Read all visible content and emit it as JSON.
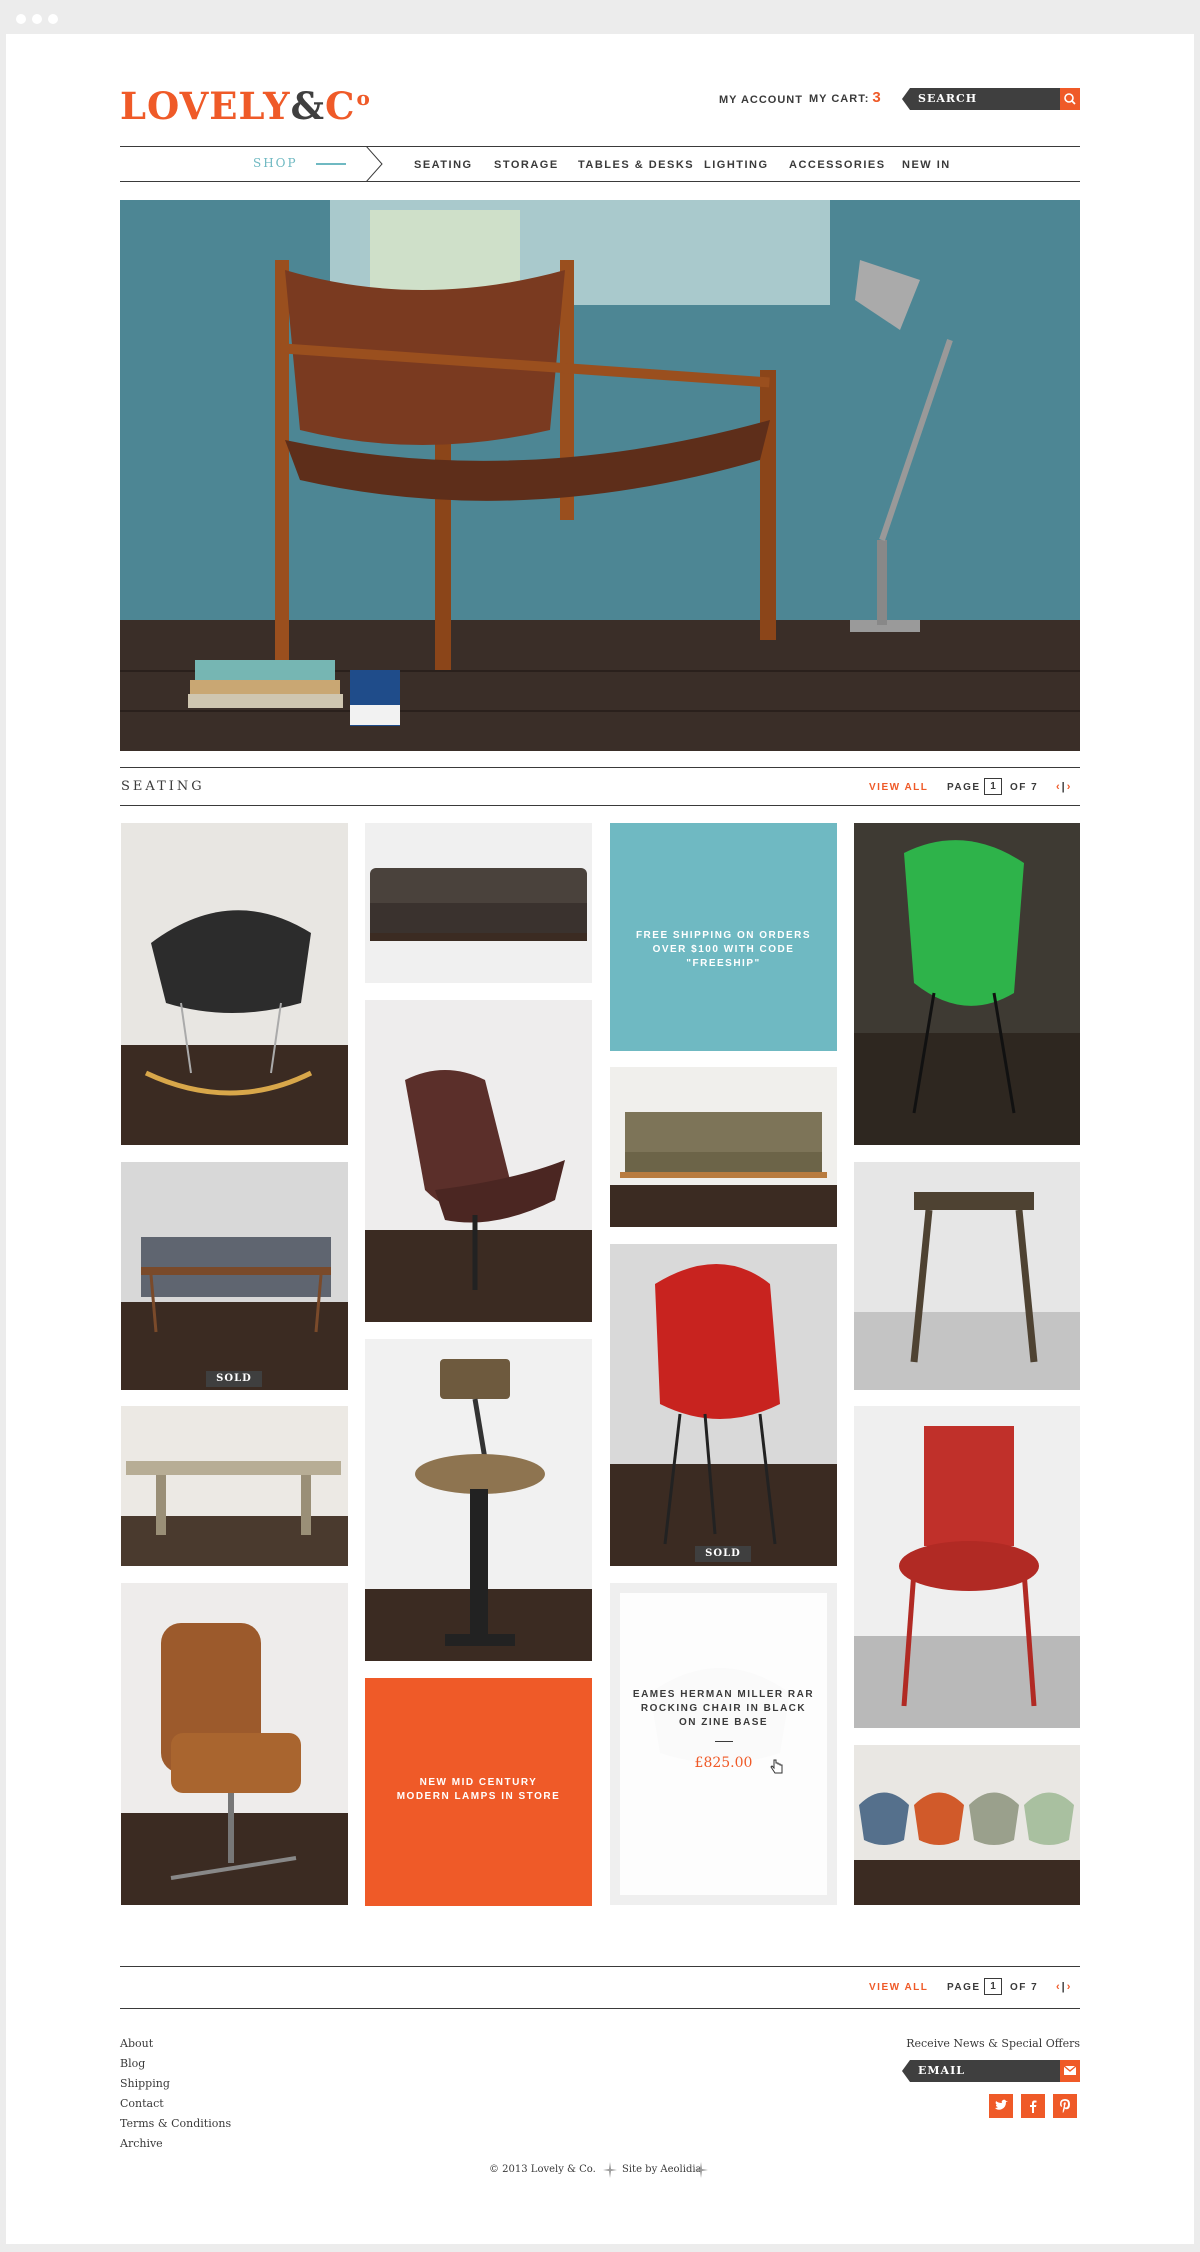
{
  "brand": {
    "logo_main": "LOVELY",
    "logo_amp": "&",
    "logo_co": "C",
    "logo_sup": "o",
    "accent_color": "#ef5a28",
    "secondary_color": "#6fb9c2",
    "dark_color": "#3f3f3f"
  },
  "header": {
    "account_label": "MY ACCOUNT",
    "cart_label": "MY CART:",
    "cart_count": "3",
    "search_placeholder": "SEARCH",
    "search_icon": "search-icon"
  },
  "nav": {
    "shop_label": "SHOP",
    "items": [
      {
        "label": "SEATING"
      },
      {
        "label": "STORAGE"
      },
      {
        "label": "TABLES & DESKS"
      },
      {
        "label": "LIGHTING"
      },
      {
        "label": "ACCESSORIES"
      },
      {
        "label": "NEW IN"
      }
    ]
  },
  "section": {
    "title": "SEATING",
    "view_all": "VIEW ALL",
    "page_label": "PAGE",
    "page_current": "1",
    "page_total": "OF 7",
    "prev": "‹",
    "sep": "|",
    "next": "›"
  },
  "grid": {
    "sold_label": "SOLD",
    "promo_shipping": "FREE SHIPPING ON ORDERS OVER $100 WITH CODE \"FREESHIP\"",
    "promo_lamps": "NEW MID CENTURY MODERN LAMPS IN STORE",
    "hover_product_name": "EAMES HERMAN MILLER RAR ROCKING CHAIR IN BLACK ON ZINE BASE",
    "hover_product_price": "£825.00"
  },
  "footer": {
    "links": [
      {
        "label": "About"
      },
      {
        "label": "Blog"
      },
      {
        "label": "Shipping"
      },
      {
        "label": "Contact"
      },
      {
        "label": "Terms & Conditions"
      },
      {
        "label": "Archive"
      }
    ],
    "newsletter_label": "Receive News & Special Offers",
    "email_placeholder": "EMAIL",
    "social_icons": [
      "twitter-icon",
      "facebook-icon",
      "pinterest-icon"
    ],
    "copyright": "© 2013 Lovely & Co.",
    "credit": "Site by Aeolidia"
  }
}
